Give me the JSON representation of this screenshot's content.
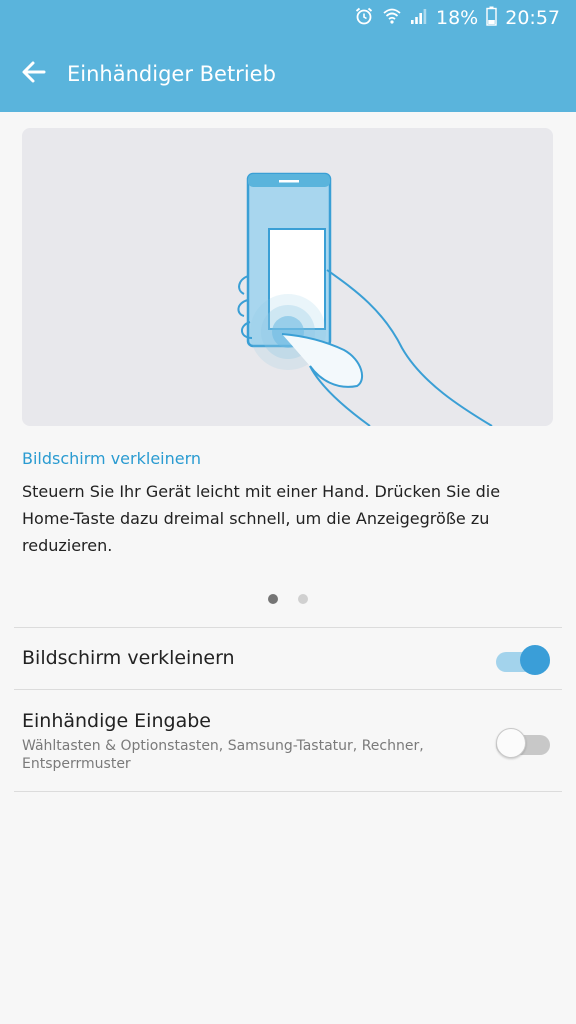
{
  "status_bar": {
    "battery_percent": "18%",
    "time": "20:57",
    "icons": [
      "alarm-icon",
      "wifi-icon",
      "signal-icon",
      "battery-icon"
    ]
  },
  "app_bar": {
    "title": "Einhändiger Betrieb",
    "back_icon": "arrow-left-icon"
  },
  "tutorial": {
    "heading": "Bildschirm verkleinern",
    "description": "Steuern Sie Ihr Gerät leicht mit einer Hand. Drücken Sie die Home-Taste dazu dreimal schnell, um die Anzeigegröße zu reduzieren.",
    "pages_total": 2,
    "page_active": 1
  },
  "settings": [
    {
      "title": "Bildschirm verkleinern",
      "subtitle": "",
      "enabled": true
    },
    {
      "title": "Einhändige Eingabe",
      "subtitle": "Wähltasten & Optionstasten, Samsung-Tastatur, Rechner, Entsperrmuster",
      "enabled": false
    }
  ],
  "colors": {
    "accent": "#5ab4dc",
    "link_heading": "#2a9bd1",
    "toggle_on": "#3a9ed8",
    "toggle_off": "#c8c8c8",
    "background": "#f7f7f7"
  }
}
